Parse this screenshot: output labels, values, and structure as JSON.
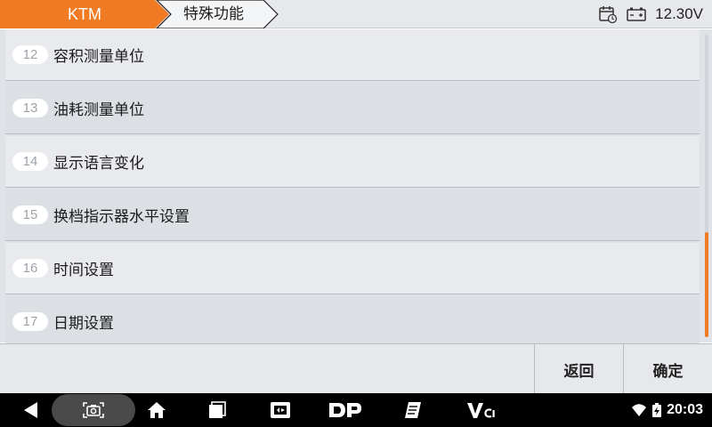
{
  "header": {
    "breadcrumb_root": "KTM",
    "breadcrumb_current": "特殊功能",
    "voltage": "12.30V",
    "accent_color": "#f07b22"
  },
  "list": {
    "items": [
      {
        "num": "12",
        "label": "容积测量单位"
      },
      {
        "num": "13",
        "label": "油耗测量单位"
      },
      {
        "num": "14",
        "label": "显示语言变化"
      },
      {
        "num": "15",
        "label": "换档指示器水平设置"
      },
      {
        "num": "16",
        "label": "时间设置"
      },
      {
        "num": "17",
        "label": "日期设置"
      }
    ]
  },
  "actions": {
    "back_label": "返回",
    "ok_label": "确定"
  },
  "navbar": {
    "time": "20:03",
    "icons": [
      "back-icon",
      "screenshot-icon",
      "home-icon",
      "recents-icon",
      "vci-manager-icon",
      "dp-icon",
      "notes-icon",
      "vci-icon",
      "wifi-icon",
      "battery-charging-icon"
    ]
  }
}
